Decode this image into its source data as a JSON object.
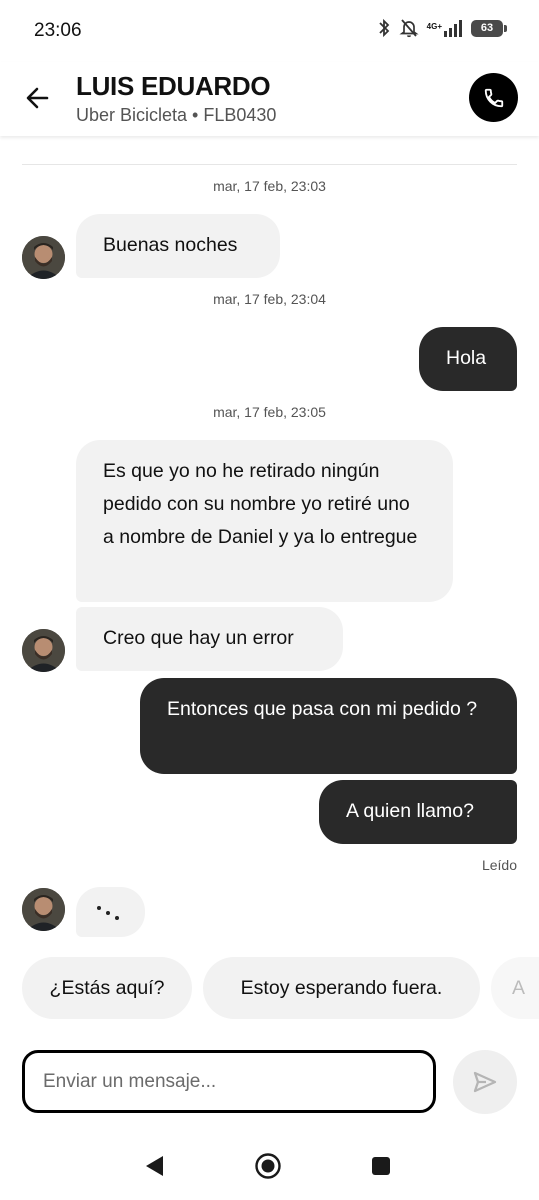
{
  "status_bar": {
    "time": "23:06",
    "network": "4G+",
    "battery": "63"
  },
  "header": {
    "driver_name": "LUIS EDUARDO",
    "subtitle": "Uber Bicicleta • FLB0430",
    "back_icon": "arrow-left-icon",
    "call_icon": "phone-icon"
  },
  "messages": {
    "ts1": "mar, 17 feb, 23:03",
    "m1": "Buenas noches",
    "ts2": "mar, 17 feb, 23:04",
    "m2": "Hola",
    "ts3": "mar, 17 feb, 23:05",
    "m3": "Es que yo no he retirado ningún pedido con su nombre yo retiré uno a nombre de Daniel y ya lo entregue",
    "m4": "Creo que hay un error",
    "m5": "Entonces que pasa con mi pedido ?",
    "m6": "A quien llamo?",
    "read_receipt": "Leído"
  },
  "quick_replies": [
    "¿Estás aquí?",
    "Estoy esperando fuera.",
    "A"
  ],
  "composer": {
    "placeholder": "Enviar un mensaje...",
    "send_icon": "send-arrow-icon"
  },
  "colors": {
    "outgoing_bubble": "#292929",
    "incoming_bubble": "#f2f2f2",
    "call_button": "#000000"
  }
}
